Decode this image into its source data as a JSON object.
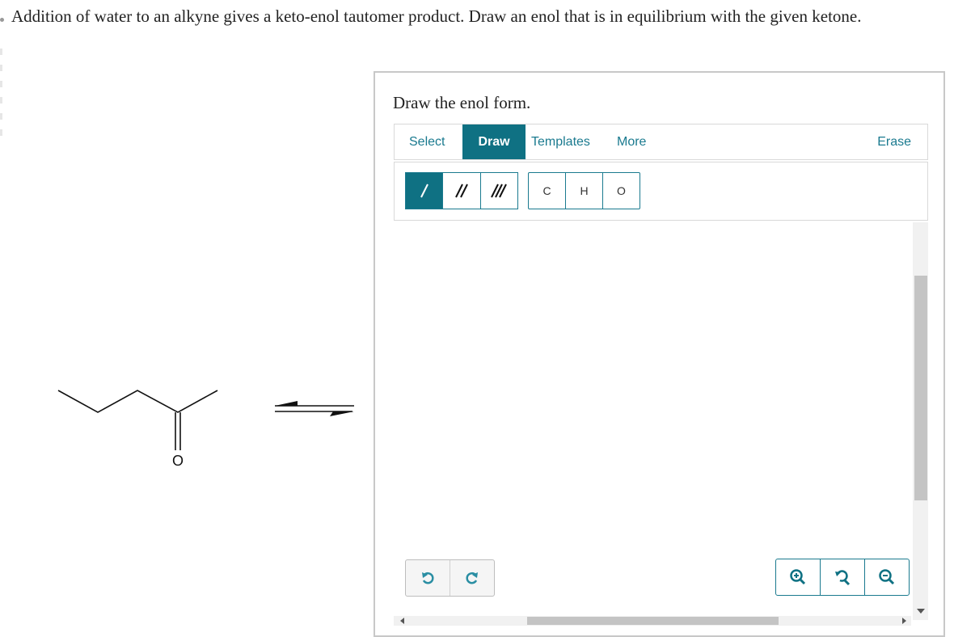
{
  "question": {
    "text": "Addition of water to an alkyne gives a keto-enol tautomer product. Draw an enol that is in equilibrium with the given ketone."
  },
  "molecule": {
    "oxygen_label": "O"
  },
  "panel": {
    "title": "Draw the enol form.",
    "tabs": {
      "select": "Select",
      "draw": "Draw",
      "templates": "Templates",
      "more": "More",
      "erase": "Erase"
    },
    "active_tab": "Draw",
    "bond_tools": [
      "single-bond",
      "double-bond",
      "triple-bond"
    ],
    "active_bond_tool": "single-bond",
    "atoms": [
      "C",
      "H",
      "O"
    ]
  },
  "colors": {
    "accent": "#0f7183",
    "accent_text": "#1a7a8f",
    "border": "#c8c8c8"
  }
}
